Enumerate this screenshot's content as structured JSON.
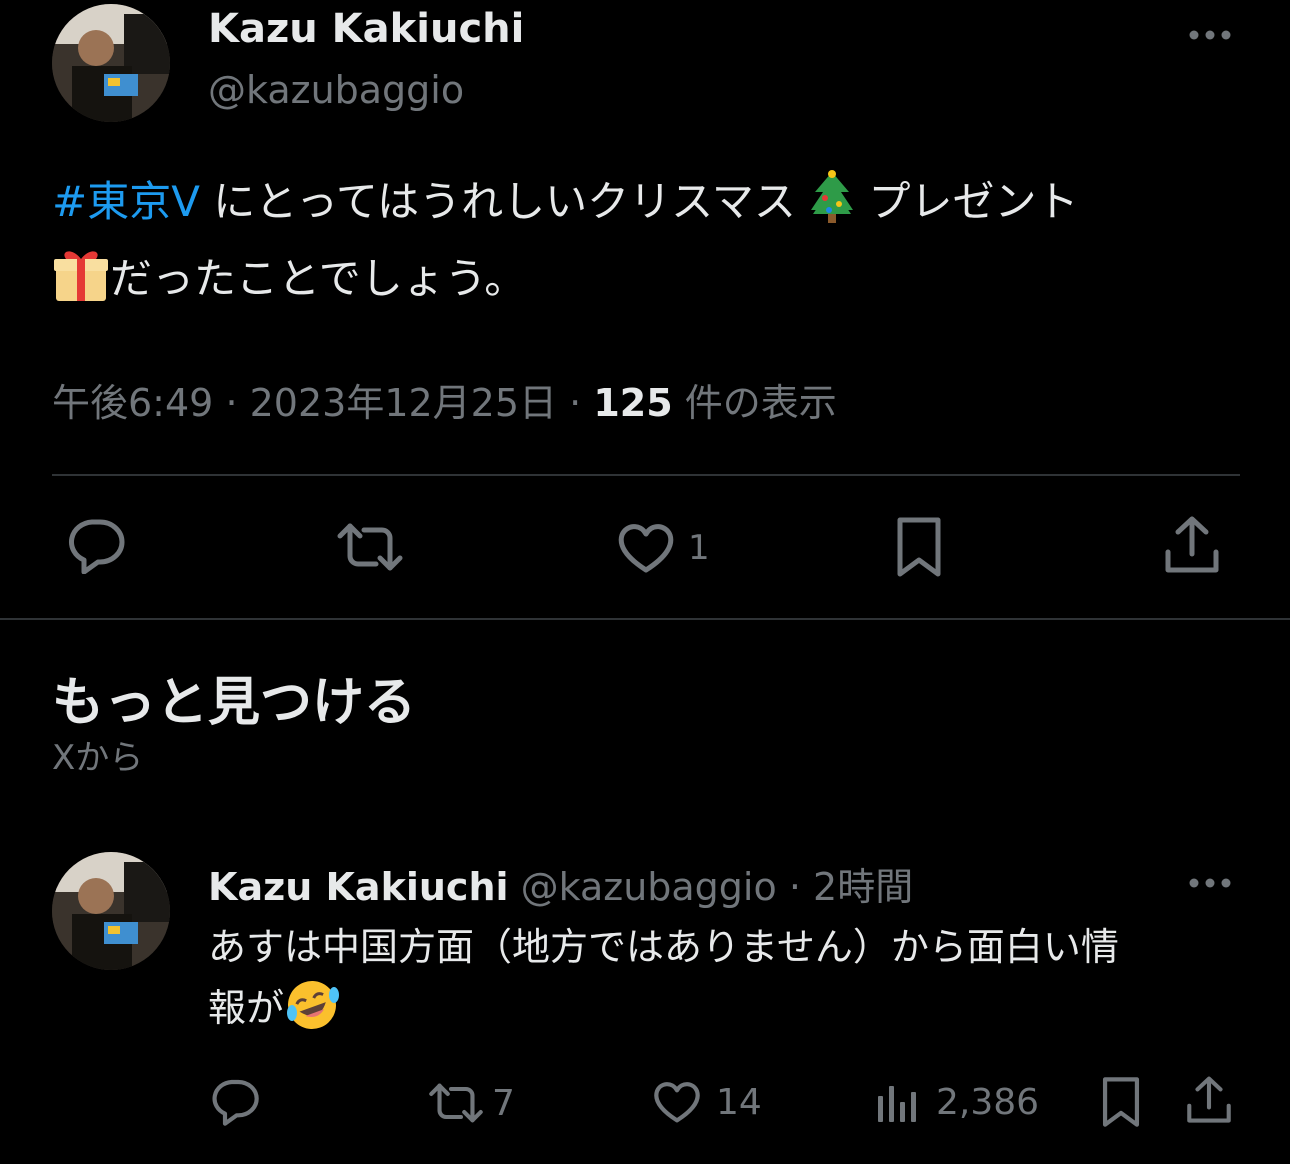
{
  "main_post": {
    "author_name": "Kazu Kakiuchi",
    "handle": "@kazubaggio",
    "hashtag": "#東京V",
    "text_line1": " にとってはうれしいクリスマス",
    "text_line1_after_tree": " プレゼント",
    "text_line2": "だったことでしょう。",
    "time": "午後6:49",
    "sep": "·",
    "date": "2023年12月25日",
    "views_count": "125",
    "views_label": "件の表示",
    "actions": {
      "reply_count": "",
      "repost_count": "",
      "like_count": "1",
      "bookmark_count": "",
      "share_count": ""
    }
  },
  "discover": {
    "title": "もっと見つける",
    "subtitle": "Xから"
  },
  "reply_post": {
    "author_name": "Kazu Kakiuchi",
    "handle": "@kazubaggio",
    "sep": "·",
    "time_ago": "2時間",
    "text_line1": "あすは中国方面（地方ではありません）から面白い情",
    "text_line2": "報が",
    "actions": {
      "reply_count": "",
      "repost_count": "7",
      "like_count": "14",
      "views_count": "2,386"
    }
  },
  "colors": {
    "background": "#000000",
    "text": "#e7e9ea",
    "muted": "#71767b",
    "link": "#1d9bf0",
    "divider": "#2f3336"
  },
  "icons": [
    "more-icon",
    "reply-icon",
    "repost-icon",
    "like-icon",
    "bookmark-icon",
    "share-icon",
    "views-icon",
    "christmas-tree-emoji",
    "gift-emoji",
    "rofl-emoji"
  ]
}
